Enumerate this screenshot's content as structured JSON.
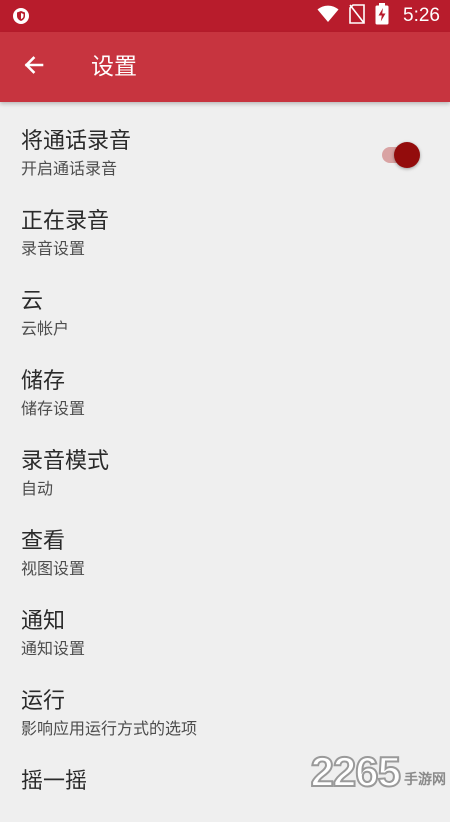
{
  "status_bar": {
    "time": "5:26",
    "icons": [
      "shield-icon",
      "wifi-icon",
      "no-sim-icon",
      "battery-charging-icon"
    ]
  },
  "app_bar": {
    "title": "设置",
    "back_icon": "arrow-left-icon"
  },
  "settings": [
    {
      "title": "将通话录音",
      "summary": "开启通话录音",
      "toggle": true
    },
    {
      "title": "正在录音",
      "summary": "录音设置"
    },
    {
      "title": "云",
      "summary": "云帐户"
    },
    {
      "title": "储存",
      "summary": "储存设置"
    },
    {
      "title": "录音模式",
      "summary": "自动"
    },
    {
      "title": "查看",
      "summary": "视图设置"
    },
    {
      "title": "通知",
      "summary": "通知设置"
    },
    {
      "title": "运行",
      "summary": "影响应用运行方式的选项"
    },
    {
      "title": "摇一摇",
      "summary": ""
    }
  ],
  "watermark": {
    "number": "2265",
    "text": "手游网"
  },
  "colors": {
    "status_bar": "#b81c2c",
    "app_bar": "#c7343f",
    "background": "#efefef",
    "toggle_thumb": "#930c0c",
    "toggle_track": "#d9a3a3"
  }
}
